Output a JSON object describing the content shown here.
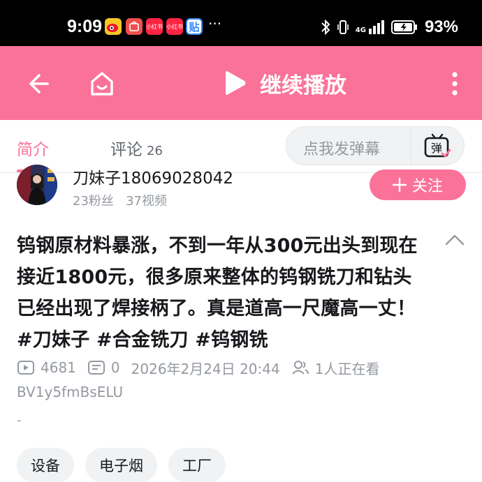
{
  "status_bar": {
    "time": "9:09",
    "apps": [
      {
        "name": "weibo",
        "label": "微",
        "color": "#e6162d"
      },
      {
        "name": "huawei-store",
        "label": "HW",
        "color": "#f04e4e"
      },
      {
        "name": "xiaohongshu",
        "label": "小红书",
        "color": "#ff2442"
      },
      {
        "name": "xiaohongshu-2",
        "label": "小红书",
        "color": "#ff2442"
      },
      {
        "name": "tieba",
        "label": "贴",
        "color": "#3388ff"
      }
    ],
    "more": "···",
    "network": "4G",
    "battery": "93%"
  },
  "topbar": {
    "continue_label": "继续播放",
    "background": "#fb7299"
  },
  "tabs": {
    "intro": "简介",
    "comments": "评论",
    "comment_count": "26"
  },
  "danmaku": {
    "placeholder": "点我发弹幕",
    "button_glyph": "弹"
  },
  "uploader": {
    "name": "刀妹子18069028042",
    "fans": "23粉丝",
    "videos": "37视频",
    "follow_label": "关注"
  },
  "video": {
    "title": "钨钢原材料暴涨，不到一年从300元出头到现在接近1800元，很多原来整体的钨钢铣刀和钻头已经出现了焊接柄了。真是道高一尺魔高一丈！ #刀妹子 #合金铣刀 #钨钢铣",
    "views": "4681",
    "danmaku_count": "0",
    "publish_time": "2026年2月24日 20:44",
    "watching": "1人正在看",
    "bvid": "BV1y5fmBsELU",
    "extra": "-"
  },
  "tags": [
    "设备",
    "电子烟",
    "工厂"
  ],
  "colors": {
    "accent": "#fb7299",
    "muted_text": "#9499a0",
    "chip_bg": "#f1f2f3"
  }
}
